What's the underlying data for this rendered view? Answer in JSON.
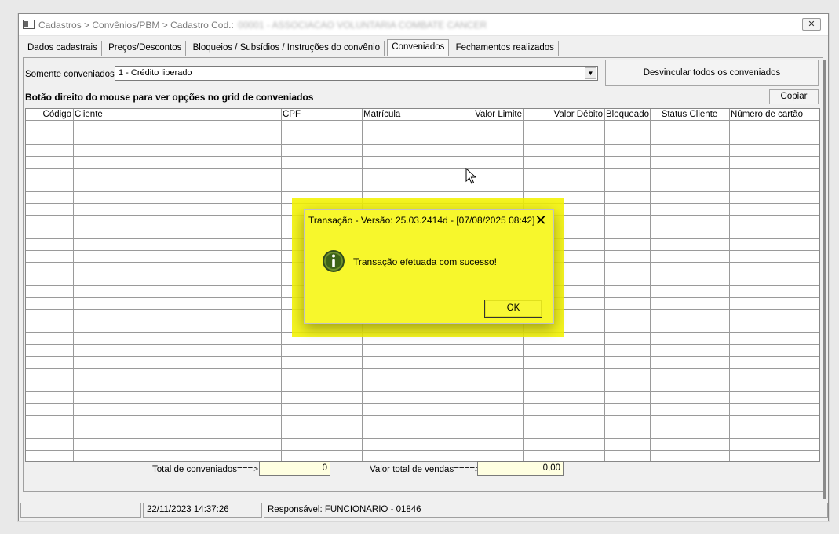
{
  "window": {
    "title_path": "Cadastros > Convênios/PBM > Cadastro",
    "title_cod_label": "Cod.:",
    "title_cod_value": "00001 - ASSOCIACAO VOLUNTARIA COMBATE CANCER",
    "close_glyph": "✕"
  },
  "tabs": [
    {
      "label": "Dados cadastrais",
      "active": false
    },
    {
      "label": "Preços/Descontos",
      "active": false
    },
    {
      "label": "Bloqueios / Subsídios / Instruções do convênio",
      "active": false
    },
    {
      "label": "Conveniados",
      "active": true
    },
    {
      "label": "Fechamentos realizados",
      "active": false
    }
  ],
  "filter": {
    "label": "Somente conveniados",
    "selected": "1 - Crédito liberado"
  },
  "unlink_button_label": "Desvincular todos os conveniados",
  "grid_hint": "Botão direito do mouse para ver opções no grid de conveniados",
  "copy_button": {
    "first_letter": "C",
    "rest": "opiar"
  },
  "grid": {
    "columns": [
      "Código",
      "Cliente",
      "CPF",
      "Matrícula",
      "Valor Limite",
      "Valor Débito",
      "Bloqueado",
      "Status Cliente",
      "Número de cartão"
    ],
    "rows": []
  },
  "totals": {
    "count_label": "Total de conveniados===>",
    "count_value": "0",
    "sales_label": "Valor total de vendas====>",
    "sales_value": "0,00"
  },
  "status_bar": {
    "cell1": "",
    "datetime": "22/11/2023 14:37:26",
    "responsavel": "Responsável: FUNCIONARIO - 01846"
  },
  "dialog": {
    "title": "Transação - Versão: 25.03.2414d - [07/08/2025 08:42]",
    "close_glyph": "✕",
    "icon": "info-icon",
    "message": "Transação efetuada com sucesso!",
    "ok_label": "OK",
    "highlight_color": "#f2f200"
  }
}
